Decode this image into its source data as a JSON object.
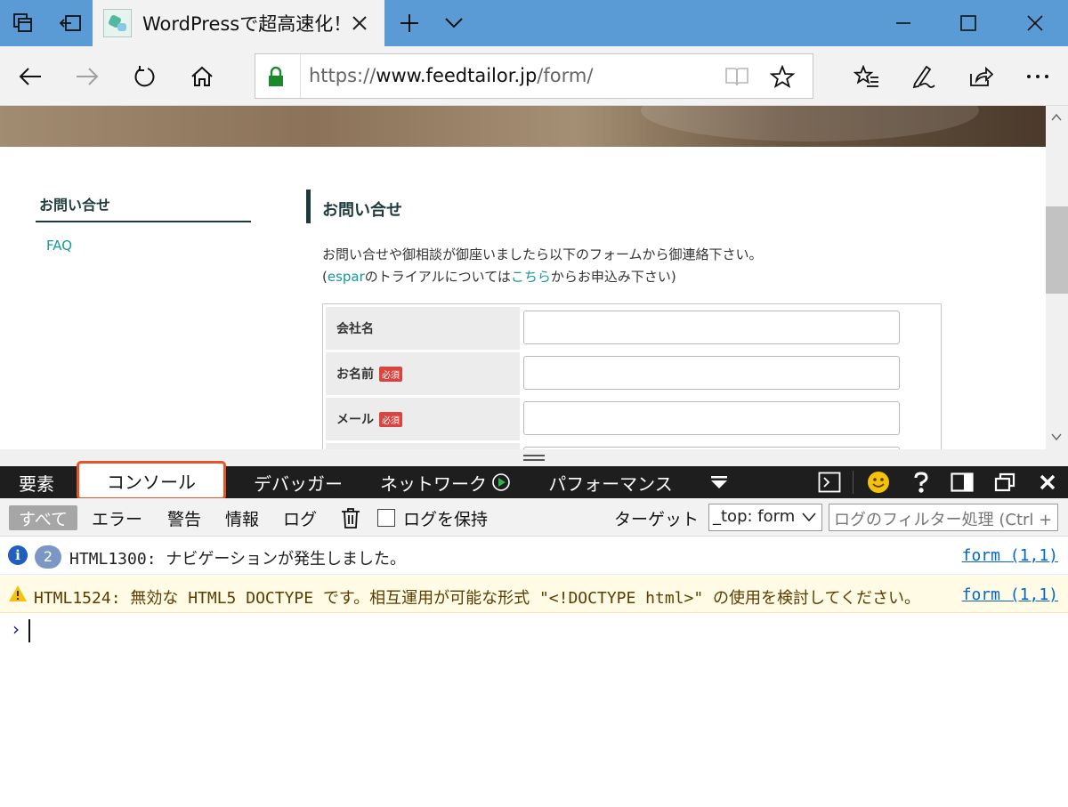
{
  "browser": {
    "tab_title": "WordPressで超高速化！",
    "url": {
      "prefix": "https://",
      "host": "www.feedtailor.jp",
      "path": "/form/"
    }
  },
  "page": {
    "sidebar": {
      "title": "お問い合せ",
      "faq": "FAQ"
    },
    "heading": "お問い合せ",
    "intro_line1": "お問い合せや御相談が御座いましたら以下のフォームから御連絡下さい。",
    "intro_line2": {
      "open": "(",
      "espar": "espar",
      "mid": "のトライアルについては",
      "here": "こちら",
      "tail": "からお申込み下さい)"
    },
    "form": {
      "company_label": "会社名",
      "name_label": "お名前",
      "email_label": "メール",
      "required_badge": "必須"
    }
  },
  "devtools": {
    "tabs": [
      "要素",
      "コンソール",
      "デバッガー",
      "ネットワーク",
      "パフォーマンス"
    ],
    "active_tab": "コンソール",
    "filters": {
      "all": "すべて",
      "errors": "エラー",
      "warnings": "警告",
      "info": "情報",
      "logs": "ログ",
      "preserve_log": "ログを保持",
      "target_label": "ターゲット",
      "target_value": "_top: form",
      "filter_placeholder": "ログのフィルター処理 (Ctrl +"
    },
    "messages": [
      {
        "level": "info",
        "count": "2",
        "text": "HTML1300: ナビゲーションが発生しました。",
        "source": "form (1,1)"
      },
      {
        "level": "warning",
        "text": "HTML1524: 無効な HTML5 DOCTYPE です。相互運用が可能な形式 \"<!DOCTYPE html>\" の使用を検討してください。",
        "source": "form (1,1)"
      }
    ],
    "prompt": "›"
  },
  "colors": {
    "titlebar": "#5b9bd5",
    "accent_teal": "#159a9c",
    "heading_dark": "#1f3a3a",
    "required_red": "#d9443f",
    "active_tab_border": "#e55424",
    "link_blue": "#0066cc",
    "warning_bg": "#fffbe5"
  }
}
